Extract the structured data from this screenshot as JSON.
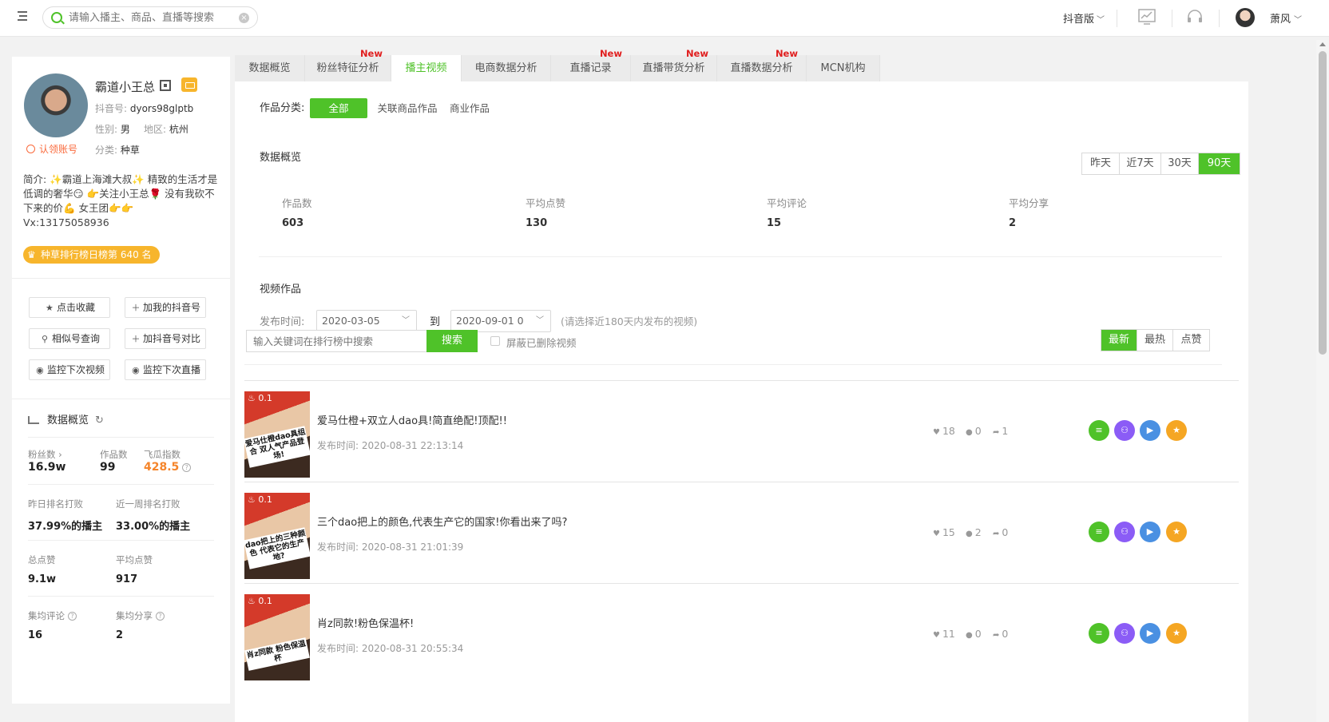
{
  "topbar": {
    "search_placeholder": "请输入播主、商品、直播等搜索",
    "version": "抖音版",
    "user": "萧风"
  },
  "profile": {
    "name": "霸道小王总",
    "douyin_id_label": "抖音号:",
    "douyin_id": "dyors98glptb",
    "gender_label": "性别:",
    "gender": "男",
    "region_label": "地区:",
    "region": "杭州",
    "claim": "认领账号",
    "category_label": "分类:",
    "category": "种草",
    "bio": "简介: ✨霸道上海滩大叔✨ 精致的生活才是低调的奢华😏 👉关注小王总🌹 没有我砍不下来的价💪 女王团👉👉 Vx:13175058936",
    "rank_badge": "种草排行榜日榜第 640 名"
  },
  "actions": [
    {
      "label": "点击收藏",
      "icon": "star-icon"
    },
    {
      "label": "加我的抖音号",
      "icon": "plus-icon"
    },
    {
      "label": "相似号查询",
      "icon": "search-icon"
    },
    {
      "label": "加抖音号对比",
      "icon": "plus-icon"
    },
    {
      "label": "监控下次视频",
      "icon": "eye-icon"
    },
    {
      "label": "监控下次直播",
      "icon": "eye-icon"
    }
  ],
  "stats": {
    "title": "数据概览",
    "fans_label": "粉丝数",
    "fans": "16.9w",
    "works_label": "作品数",
    "works": "99",
    "feigua_label": "飞瓜指数",
    "feigua": "428.5",
    "yesterday_rank_label": "昨日排名打败",
    "yesterday_rank": "37.99%的播主",
    "week_rank_label": "近一周排名打败",
    "week_rank": "33.00%的播主",
    "total_likes_label": "总点赞",
    "total_likes": "9.1w",
    "avg_likes_label": "平均点赞",
    "avg_likes": "917",
    "avg_comments_label": "集均评论",
    "avg_comments": "16",
    "avg_shares_label": "集均分享",
    "avg_shares": "2"
  },
  "tabs": [
    {
      "label": "数据概览",
      "new": ""
    },
    {
      "label": "粉丝特征分析",
      "new": "New"
    },
    {
      "label": "播主视频",
      "new": ""
    },
    {
      "label": "电商数据分析",
      "new": ""
    },
    {
      "label": "直播记录",
      "new": "New"
    },
    {
      "label": "直播带货分析",
      "new": "New"
    },
    {
      "label": "直播数据分析",
      "new": "New"
    },
    {
      "label": "MCN机构",
      "new": ""
    }
  ],
  "filter": {
    "label": "作品分类:",
    "options": [
      "全部",
      "关联商品作品",
      "商业作品"
    ]
  },
  "overview": {
    "title": "数据概览",
    "ranges": [
      "昨天",
      "近7天",
      "30天",
      "90天"
    ],
    "metrics": [
      {
        "label": "作品数",
        "value": "603"
      },
      {
        "label": "平均点赞",
        "value": "130"
      },
      {
        "label": "平均评论",
        "value": "15"
      },
      {
        "label": "平均分享",
        "value": "2"
      }
    ]
  },
  "videos_section": {
    "title": "视频作品",
    "time_label": "发布时间:",
    "start_date": "2020-03-05",
    "to_label": "到",
    "end_date": "2020-09-01 0",
    "hint": "(请选择近180天内发布的视频)",
    "keyword_placeholder": "输入关键词在排行榜中搜索",
    "search_btn": "搜索",
    "hide_deleted": "屏蔽已删除视频",
    "sorts": [
      "最新",
      "最热",
      "点赞"
    ]
  },
  "videos": [
    {
      "play": "0.1",
      "caption": "爱马仕橙dao具组合 双人气产品登场!",
      "title": "爱马仕橙+双立人dao具!简直绝配!顶配!!",
      "time": "发布时间: 2020-08-31 22:13:14",
      "likes": "18",
      "comments": "0",
      "shares": "1"
    },
    {
      "play": "0.1",
      "caption": "dao把上的三种颜色 代表它的生产地?",
      "title": "三个dao把上的颜色,代表生产它的国家!你看出来了吗?",
      "time": "发布时间: 2020-08-31 21:01:39",
      "likes": "15",
      "comments": "2",
      "shares": "0"
    },
    {
      "play": "0.1",
      "caption": "肖z同款 粉色保温杯",
      "title": "肖z同款!粉色保温杯!",
      "time": "发布时间: 2020-08-31 20:55:34",
      "likes": "11",
      "comments": "0",
      "shares": "0"
    }
  ],
  "op_colors": [
    "#4fc229",
    "#8b5cf6",
    "#4a90e2",
    "#f5a623"
  ]
}
